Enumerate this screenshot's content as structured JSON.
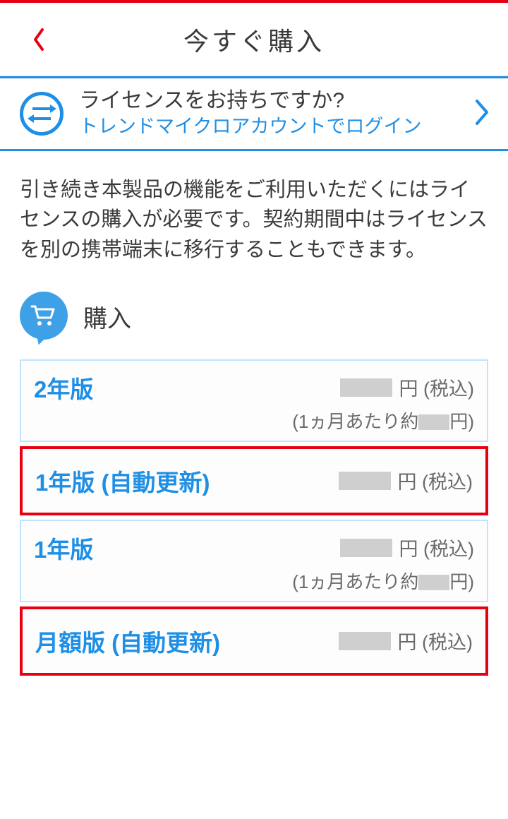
{
  "header": {
    "title": "今すぐ購入"
  },
  "login": {
    "question": "ライセンスをお持ちですか?",
    "link": "トレンドマイクロアカウントでログイン"
  },
  "description": "引き続き本製品の機能をご利用いただくにはライセンスの購入が必要です。契約期間中はライセンスを別の携帯端末に移行することもできます。",
  "purchase": {
    "section_title": "購入",
    "price_suffix": "円 (税込)",
    "per_month_prefix": "(1ヵ月あたり約",
    "per_month_suffix": "円)",
    "plans": [
      {
        "name": "2年版",
        "highlight": false,
        "has_sub": true
      },
      {
        "name": "1年版 (自動更新)",
        "highlight": true,
        "has_sub": false
      },
      {
        "name": "1年版",
        "highlight": false,
        "has_sub": true
      },
      {
        "name": "月額版 (自動更新)",
        "highlight": true,
        "has_sub": false
      }
    ]
  }
}
